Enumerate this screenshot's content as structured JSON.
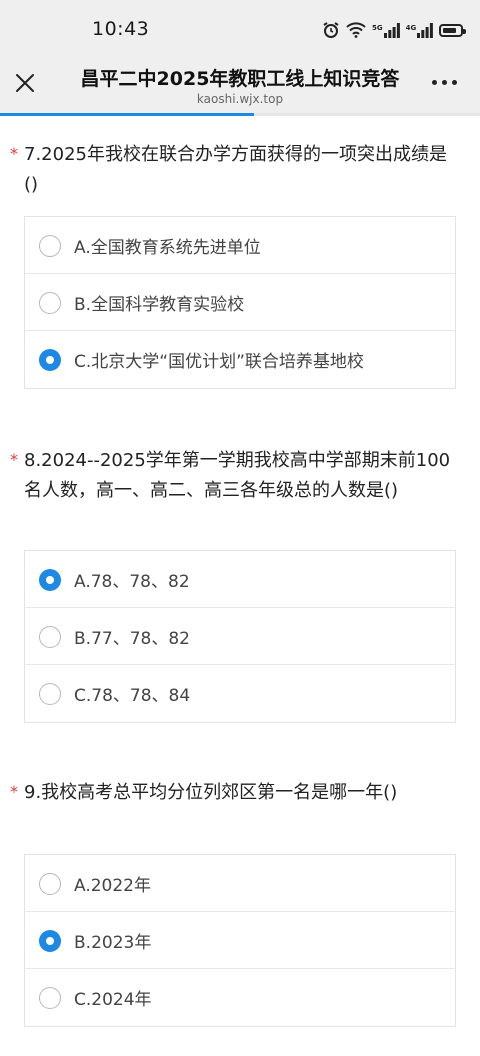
{
  "status_bar": {
    "time": "10:43",
    "icons": [
      "alarm-icon",
      "wifi-icon",
      "signal-5g-icon",
      "signal-4g-icon",
      "battery-icon"
    ],
    "signal_1_label": "5G",
    "signal_2_label": "4G"
  },
  "nav": {
    "title": "昌平二中2025年教职工线上知识竞答",
    "url": "kaoshi.wjx.top",
    "progress": 0.53
  },
  "questions": [
    {
      "title": "7.2025年我校在联合办学方面获得的一项突出成绩是()",
      "options": [
        {
          "label": "A.全国教育系统先进单位",
          "selected": false
        },
        {
          "label": "B.全国科学教育实验校",
          "selected": false
        },
        {
          "label": "C.北京大学“国优计划”联合培养基地校",
          "selected": true
        }
      ]
    },
    {
      "title": "8.2024--2025学年第一学期我校高中学部期末前100名人数，高一、高二、高三各年级总的人数是()",
      "options": [
        {
          "label": "A.78、78、82",
          "selected": true
        },
        {
          "label": "B.77、78、82",
          "selected": false
        },
        {
          "label": "C.78、78、84",
          "selected": false
        }
      ]
    },
    {
      "title": "9.我校高考总平均分位列郊区第一名是哪一年()",
      "options": [
        {
          "label": "A.2022年",
          "selected": false
        },
        {
          "label": "B.2023年",
          "selected": true
        },
        {
          "label": "C.2024年",
          "selected": false
        }
      ]
    }
  ],
  "colors": {
    "accent": "#1e88e5",
    "required_star": "#e53935",
    "bar_bg": "#efefef"
  }
}
